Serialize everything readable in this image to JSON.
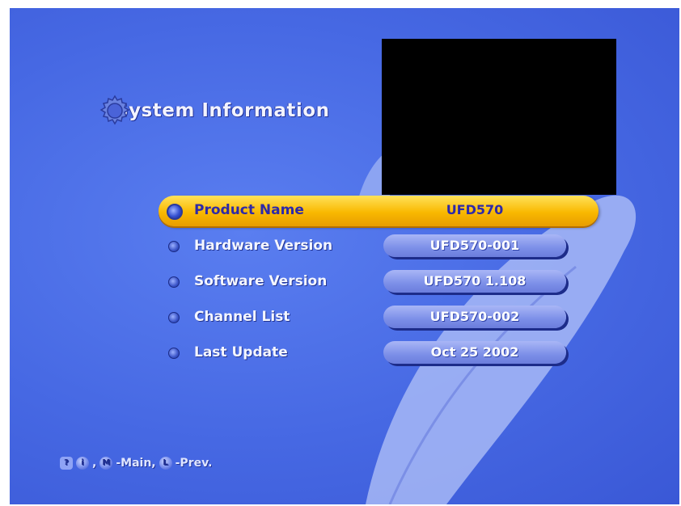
{
  "title": "System Information",
  "rows": [
    {
      "label": "Product Name",
      "value": "UFD570",
      "selected": true
    },
    {
      "label": "Hardware Version",
      "value": "UFD570-001"
    },
    {
      "label": "Software Version",
      "value": "UFD570 1.108"
    },
    {
      "label": "Channel List",
      "value": "UFD570-002"
    },
    {
      "label": "Last Update",
      "value": "Oct 25 2002"
    }
  ],
  "footer": {
    "help_icon": "?",
    "info_key": "i",
    "sep1": ",",
    "main_key": "M",
    "main_text": "-Main,",
    "prev_key": "L",
    "prev_text": "-Prev."
  },
  "icons": {
    "title": "gear-icon",
    "row_bullet": "circle-bullet-icon",
    "help": "help-icon"
  },
  "colors": {
    "background": "#4668e3",
    "highlight": "#f9b800",
    "value_pill": "#8fa0ee",
    "text": "#ffffff"
  }
}
